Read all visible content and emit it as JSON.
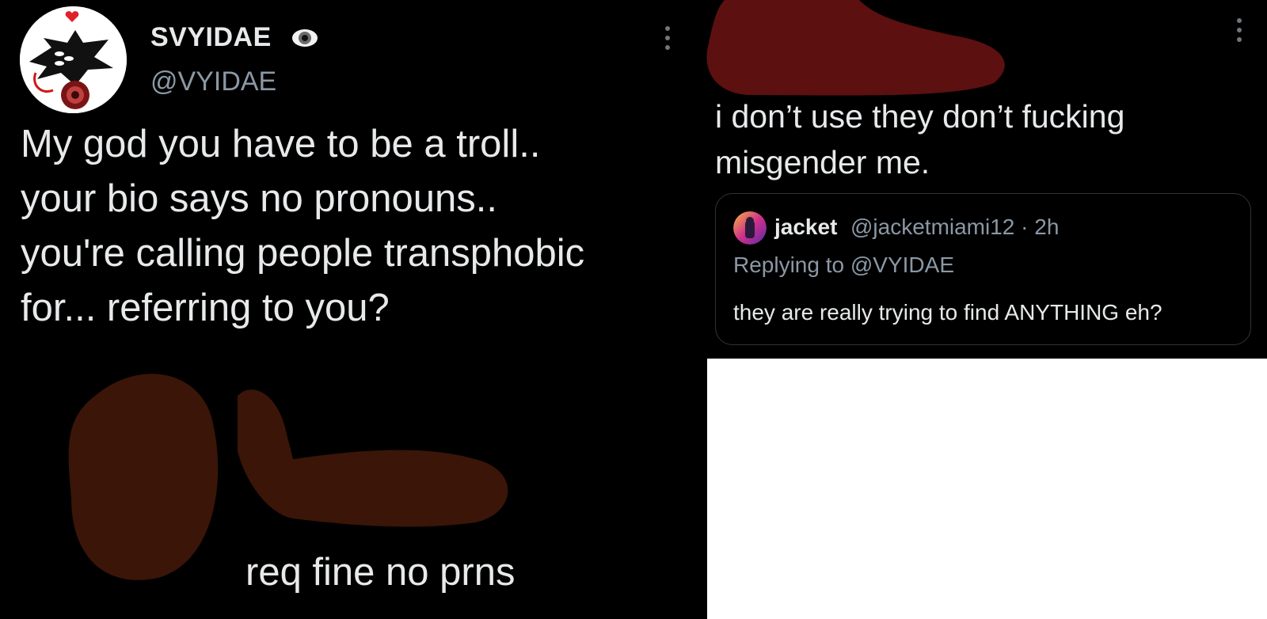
{
  "left_tweet": {
    "display_name": "SVYIDAE",
    "display_name_icon": "eye-icon",
    "handle": "@VYIDAE",
    "more_icon": "more-options-icon",
    "text_lines": [
      "My god you have to be a troll..",
      "your bio says no pronouns..",
      "you're calling people transphobic",
      "for... referring to you?"
    ],
    "profile_bio_fragment": "req fine no prns"
  },
  "right_tweet": {
    "more_icon": "more-options-icon",
    "text_lines": [
      "i don’t use they don’t fucking",
      "misgender me."
    ],
    "quoted_tweet": {
      "name": "jacket",
      "handle": "@jacketmiami12",
      "separator": "·",
      "time": "2h",
      "replying_to": "Replying to @VYIDAE",
      "text": "they are really trying to find ANYTHING eh?"
    }
  },
  "colors": {
    "background": "#000000",
    "primary_text": "#e7e9ea",
    "secondary_text": "#8b98a5",
    "border": "#2f3336",
    "redaction_brown": "#3a1508",
    "redaction_red": "#5c1010"
  }
}
